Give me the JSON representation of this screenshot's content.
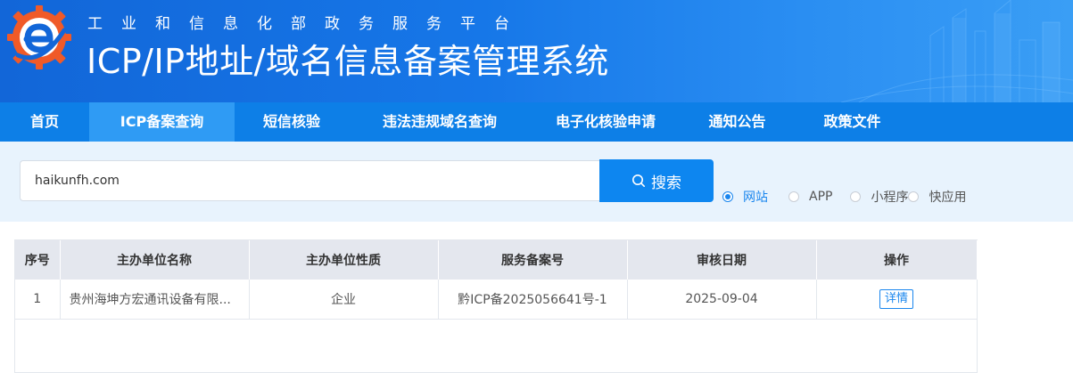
{
  "header": {
    "subtitle": "工业和信息化部政务服务平台",
    "title": "ICP/IP地址/域名信息备案管理系统",
    "logo_icon": "e-gear-logo-icon",
    "colors": {
      "brand_blue": "#1677e8",
      "logo_orange": "#f05a28"
    }
  },
  "nav": {
    "items": [
      {
        "label": "首页",
        "active": false
      },
      {
        "label": "ICP备案查询",
        "active": true
      },
      {
        "label": "短信核验",
        "active": false
      },
      {
        "label": "违法违规域名查询",
        "active": false
      },
      {
        "label": "电子化核验申请",
        "active": false
      },
      {
        "label": "通知公告",
        "active": false
      },
      {
        "label": "政策文件",
        "active": false
      }
    ]
  },
  "search": {
    "value": "haikunfh.com",
    "button_label": "搜索",
    "button_icon": "search-icon",
    "options": [
      {
        "label": "网站",
        "checked": true
      },
      {
        "label": "APP",
        "checked": false
      },
      {
        "label": "小程序",
        "checked": false
      },
      {
        "label": "快应用",
        "checked": false
      }
    ]
  },
  "table": {
    "headers": [
      "序号",
      "主办单位名称",
      "主办单位性质",
      "服务备案号",
      "审核日期",
      "操作"
    ],
    "rows": [
      {
        "index": "1",
        "org_name": "贵州海坤方宏通讯设备有限...",
        "org_type": "企业",
        "record_no": "黔ICP备2025056641号-1",
        "date": "2025-09-04",
        "action_label": "详情"
      }
    ]
  }
}
